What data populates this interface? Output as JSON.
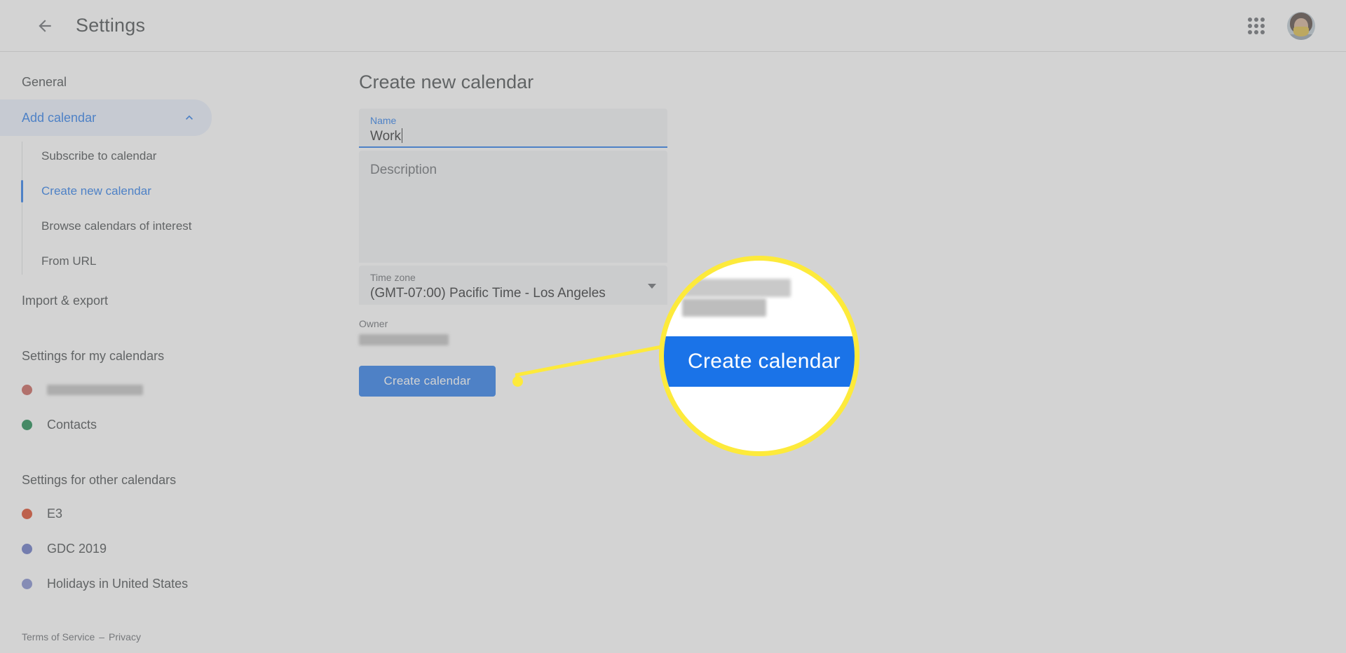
{
  "header": {
    "back_icon": "back-arrow-icon",
    "title": "Settings",
    "apps_icon": "apps-grid-icon",
    "avatar_icon": "user-avatar"
  },
  "sidebar": {
    "nav": [
      {
        "label": "General"
      },
      {
        "label": "Add calendar",
        "expanded": true,
        "chevron": "chevron-up-icon"
      }
    ],
    "subnav": [
      {
        "label": "Subscribe to calendar",
        "active": false
      },
      {
        "label": "Create new calendar",
        "active": true
      },
      {
        "label": "Browse calendars of interest",
        "active": false
      },
      {
        "label": "From URL",
        "active": false
      }
    ],
    "import_export": "Import & export",
    "my_calendars": {
      "title": "Settings for my calendars",
      "items": [
        {
          "label": "",
          "redacted": true,
          "color": "#c5564f"
        },
        {
          "label": "Contacts",
          "redacted": false,
          "color": "#0b8043"
        }
      ]
    },
    "other_calendars": {
      "title": "Settings for other calendars",
      "items": [
        {
          "label": "E3",
          "color": "#d93c18"
        },
        {
          "label": "GDC 2019",
          "color": "#5c6bc0"
        },
        {
          "label": "Holidays in United States",
          "color": "#7986cb"
        }
      ]
    },
    "footer": {
      "terms": "Terms of Service",
      "separator": "–",
      "privacy": "Privacy"
    }
  },
  "main": {
    "heading": "Create new calendar",
    "name_field": {
      "label": "Name",
      "value": "Work",
      "focused": true
    },
    "description_field": {
      "placeholder": "Description",
      "value": ""
    },
    "timezone_field": {
      "label": "Time zone",
      "value": "(GMT-07:00) Pacific Time - Los Angeles",
      "arrow_icon": "dropdown-arrow-icon"
    },
    "owner_field": {
      "label": "Owner",
      "value": "",
      "redacted": true
    },
    "create_button": "Create calendar"
  },
  "callout": {
    "magnified_button_label": "Create calendar"
  },
  "colors": {
    "accent": "#1a73e8",
    "highlight": "#fdea3b",
    "nav_active_bg": "#e8f0fe"
  }
}
